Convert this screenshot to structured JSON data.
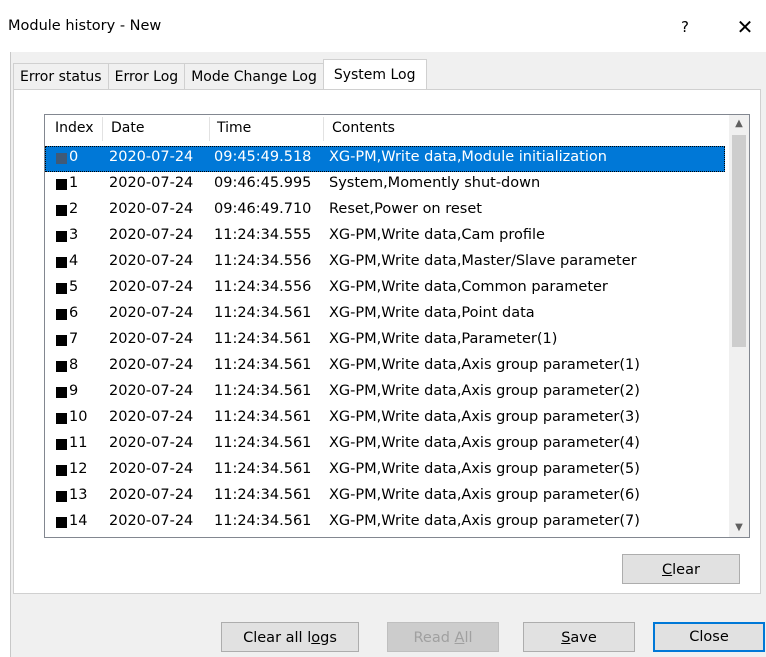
{
  "window": {
    "title": "Module history - New",
    "help": "?",
    "close": "✕"
  },
  "tabs": [
    {
      "label": "Error status"
    },
    {
      "label": "Error Log"
    },
    {
      "label": "Mode Change Log"
    },
    {
      "label": "System Log",
      "active": true
    }
  ],
  "columns": {
    "index": "Index",
    "date": "Date",
    "time": "Time",
    "contents": "Contents"
  },
  "rows": [
    {
      "index": "0",
      "date": "2020-07-24",
      "time": "09:45:49.518",
      "contents": "XG-PM,Write data,Module initialization",
      "selected": true
    },
    {
      "index": "1",
      "date": "2020-07-24",
      "time": "09:46:45.995",
      "contents": "System,Momently shut-down"
    },
    {
      "index": "2",
      "date": "2020-07-24",
      "time": "09:46:49.710",
      "contents": "Reset,Power on reset"
    },
    {
      "index": "3",
      "date": "2020-07-24",
      "time": "11:24:34.555",
      "contents": "XG-PM,Write data,Cam profile"
    },
    {
      "index": "4",
      "date": "2020-07-24",
      "time": "11:24:34.556",
      "contents": "XG-PM,Write data,Master/Slave parameter"
    },
    {
      "index": "5",
      "date": "2020-07-24",
      "time": "11:24:34.556",
      "contents": "XG-PM,Write data,Common parameter"
    },
    {
      "index": "6",
      "date": "2020-07-24",
      "time": "11:24:34.561",
      "contents": "XG-PM,Write data,Point data"
    },
    {
      "index": "7",
      "date": "2020-07-24",
      "time": "11:24:34.561",
      "contents": "XG-PM,Write data,Parameter(1)"
    },
    {
      "index": "8",
      "date": "2020-07-24",
      "time": "11:24:34.561",
      "contents": "XG-PM,Write data,Axis group parameter(1)"
    },
    {
      "index": "9",
      "date": "2020-07-24",
      "time": "11:24:34.561",
      "contents": "XG-PM,Write data,Axis group parameter(2)"
    },
    {
      "index": "10",
      "date": "2020-07-24",
      "time": "11:24:34.561",
      "contents": "XG-PM,Write data,Axis group parameter(3)"
    },
    {
      "index": "11",
      "date": "2020-07-24",
      "time": "11:24:34.561",
      "contents": "XG-PM,Write data,Axis group parameter(4)"
    },
    {
      "index": "12",
      "date": "2020-07-24",
      "time": "11:24:34.561",
      "contents": "XG-PM,Write data,Axis group parameter(5)"
    },
    {
      "index": "13",
      "date": "2020-07-24",
      "time": "11:24:34.561",
      "contents": "XG-PM,Write data,Axis group parameter(6)"
    },
    {
      "index": "14",
      "date": "2020-07-24",
      "time": "11:24:34.561",
      "contents": "XG-PM,Write data,Axis group parameter(7)"
    }
  ],
  "buttons": {
    "clear": {
      "pre": "",
      "u": "C",
      "post": "lear"
    },
    "clear_all": {
      "pre": "Clear all l",
      "u": "o",
      "post": "gs"
    },
    "read_all": {
      "pre": "Read ",
      "u": "A",
      "post": "ll",
      "disabled": true
    },
    "save": {
      "pre": "",
      "u": "S",
      "post": "ave"
    },
    "close": {
      "label": "Close"
    }
  },
  "colors": {
    "selection": "#0078d7",
    "default_border": "#0078d7"
  }
}
